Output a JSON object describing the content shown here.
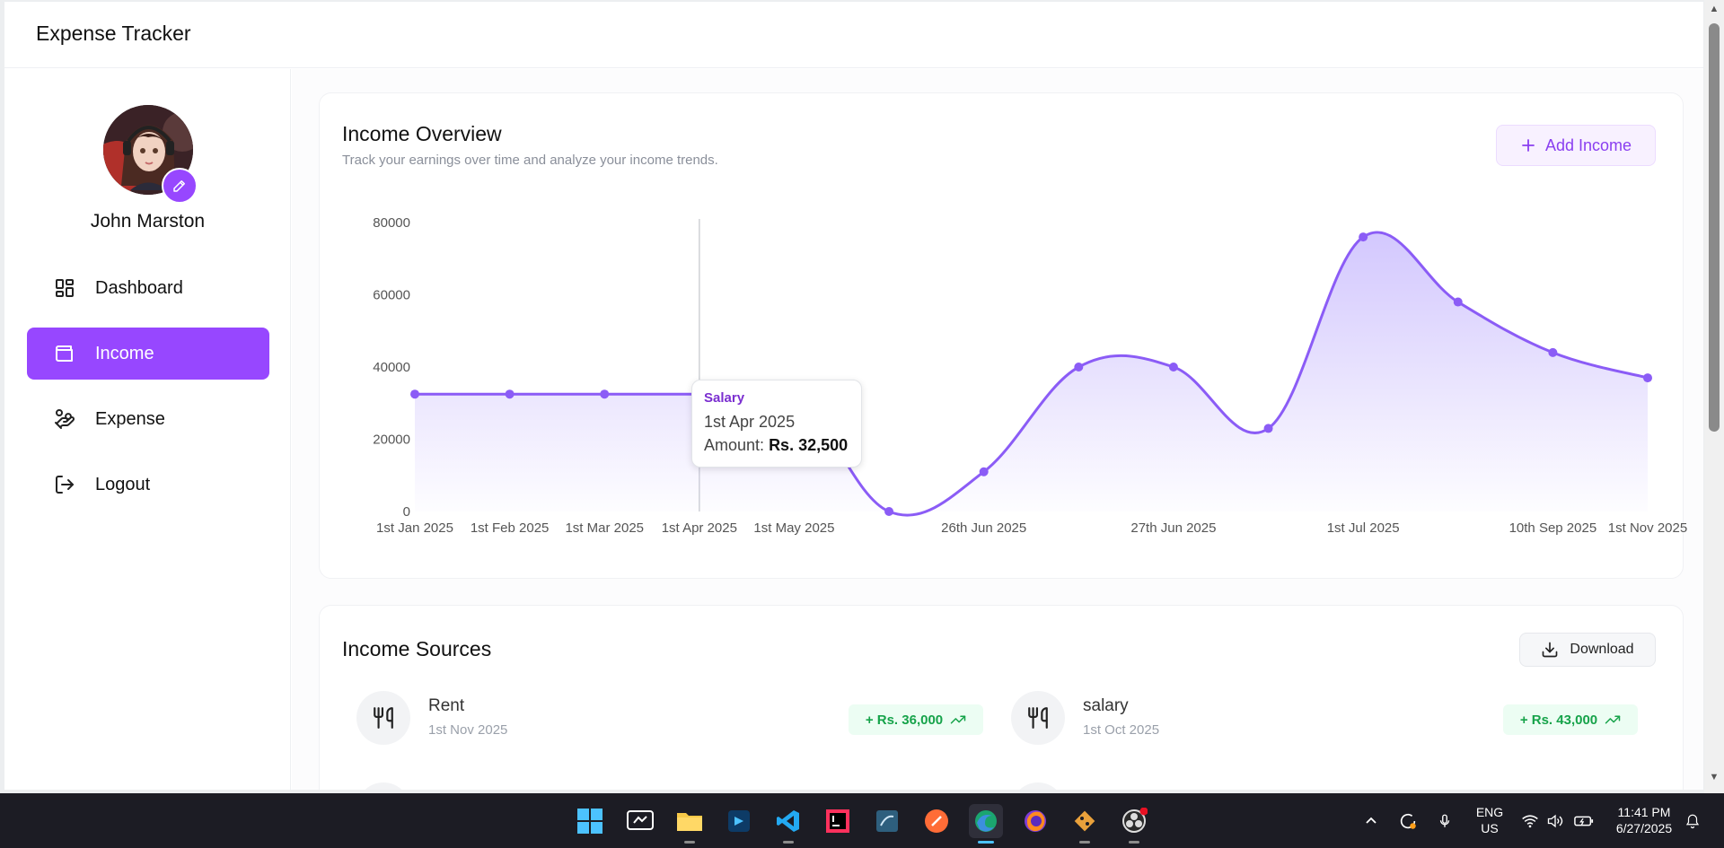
{
  "app": {
    "title": "Expense Tracker"
  },
  "user": {
    "name": "John Marston"
  },
  "nav": {
    "items": [
      {
        "label": "Dashboard",
        "icon": "dashboard-icon",
        "active": false
      },
      {
        "label": "Income",
        "icon": "wallet-icon",
        "active": true
      },
      {
        "label": "Expense",
        "icon": "hand-coins-icon",
        "active": false
      },
      {
        "label": "Logout",
        "icon": "logout-icon",
        "active": false
      }
    ]
  },
  "overview": {
    "title": "Income Overview",
    "subtitle": "Track your earnings over time and analyze your income trends.",
    "add_button": "Add Income"
  },
  "chart_data": {
    "type": "area",
    "title": "",
    "xlabel": "",
    "ylabel": "",
    "ylim": [
      0,
      80000
    ],
    "y_ticks": [
      "0",
      "20000",
      "40000",
      "60000",
      "80000"
    ],
    "x_tick_labels": [
      "1st Jan 2025",
      "1st Feb 2025",
      "1st Mar 2025",
      "1st Apr 2025",
      "1st May 2025",
      "26th Jun 2025",
      "27th Jun 2025",
      "1st Jul 2025",
      "10th Sep 2025",
      "1st Nov 2025"
    ],
    "points": [
      {
        "x": "1st Jan 2025",
        "y": 32500
      },
      {
        "x": "1st Feb 2025",
        "y": 32500
      },
      {
        "x": "1st Mar 2025",
        "y": 32500
      },
      {
        "x": "1st Apr 2025",
        "y": 32500
      },
      {
        "x": "1st May 2025",
        "y": 32500
      },
      {
        "x": "",
        "y": 0
      },
      {
        "x": "26th Jun 2025",
        "y": 11000
      },
      {
        "x": "",
        "y": 40000
      },
      {
        "x": "27th Jun 2025",
        "y": 40000
      },
      {
        "x": "",
        "y": 23000
      },
      {
        "x": "1st Jul 2025",
        "y": 76000
      },
      {
        "x": "",
        "y": 58000
      },
      {
        "x": "10th Sep 2025",
        "y": 44000
      },
      {
        "x": "1st Nov 2025",
        "y": 37000
      }
    ],
    "grid": false,
    "colors": {
      "line": "#8b5cf6",
      "fill": "#c4b5fd"
    }
  },
  "tooltip": {
    "category": "Salary",
    "date": "1st Apr 2025",
    "amount_label": "Amount:",
    "amount_value": "Rs. 32,500"
  },
  "sources": {
    "title": "Income Sources",
    "download_button": "Download",
    "items": [
      {
        "name": "Rent",
        "date": "1st Nov 2025",
        "amount": "+ Rs. 36,000",
        "icon": "fork-knife-icon"
      },
      {
        "name": "salary",
        "date": "1st Oct 2025",
        "amount": "+ Rs. 43,000",
        "icon": "fork-knife-icon"
      }
    ]
  },
  "taskbar": {
    "lang": "ENG",
    "region": "US",
    "time": "11:41 PM",
    "date": "6/27/2025",
    "apps": [
      "windows-start-icon",
      "dev-home-icon",
      "file-explorer-icon",
      "visual-studio-icon",
      "vscode-icon",
      "intellij-icon",
      "mysql-workbench-icon",
      "postman-icon",
      "edge-icon",
      "firefox-icon",
      "git-icon",
      "obs-icon"
    ]
  },
  "colors": {
    "accent": "#9747ff",
    "success": "#16a34a"
  }
}
